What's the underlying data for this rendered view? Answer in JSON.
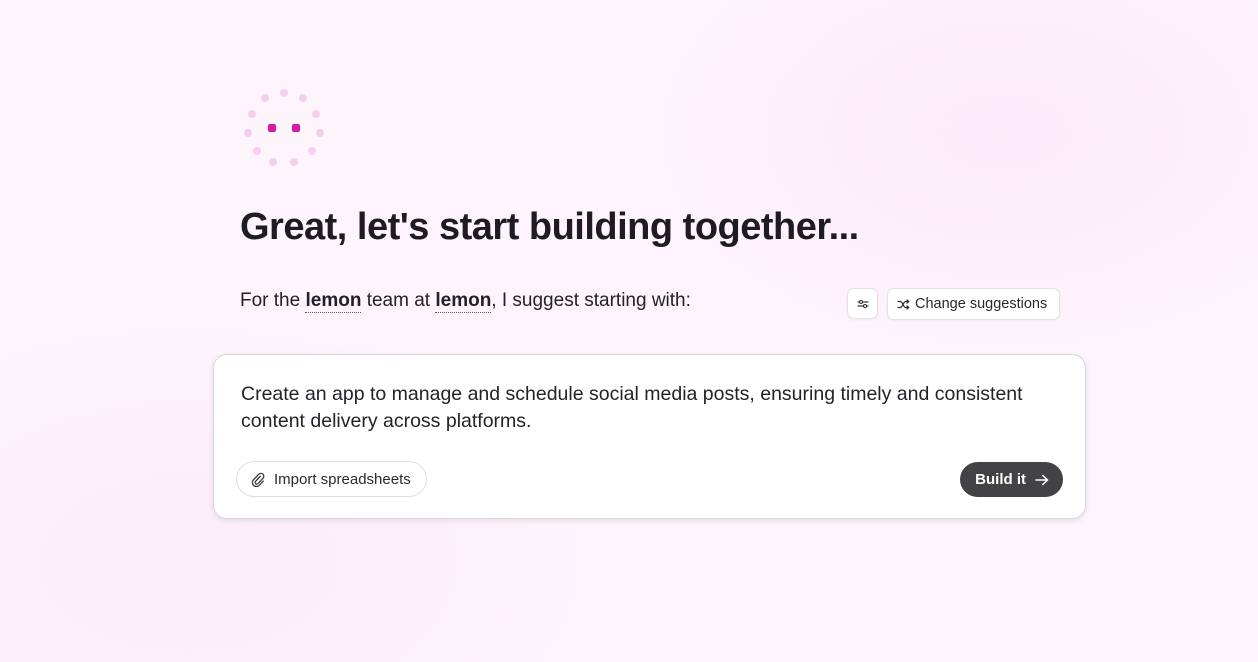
{
  "colors": {
    "background": "#fdf4fc",
    "spinner_dot": "#f7cfee",
    "spinner_eye": "#d21aa8",
    "primary_button": "#434245"
  },
  "spinner": {
    "icon": "loading-spinner-icon"
  },
  "headline": "Great, let's start building together...",
  "suggestion_line": {
    "prefix": "For the ",
    "team": "lemon",
    "middle": " team at ",
    "company": "lemon",
    "suffix": ", I suggest starting with:"
  },
  "toolbar": {
    "settings_icon": "sliders-icon",
    "change_icon": "shuffle-icon",
    "change_label": "Change suggestions"
  },
  "card": {
    "prompt": "Create an app to manage and schedule social media posts, ensuring timely and consistent content delivery across platforms.",
    "import_icon": "paperclip-icon",
    "import_label": "Import spreadsheets",
    "build_label": "Build it",
    "build_icon": "arrow-right-icon"
  }
}
